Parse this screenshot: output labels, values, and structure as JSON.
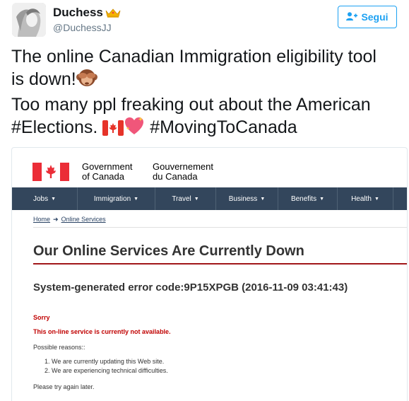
{
  "tweet": {
    "user": {
      "name": "Duchess",
      "handle": "@DuchessJJ",
      "badge_icon": "crown-icon"
    },
    "follow_button": {
      "label": "Segui",
      "icon": "add-user-icon",
      "color": "#1da1f2"
    },
    "text_lines": [
      "The online Canadian Immigration eligibility tool",
      "is down!",
      "Too many ppl freaking out about the American",
      "#Elections.",
      "#MovingToCanada"
    ],
    "emojis": [
      "see-no-evil-monkey-icon",
      "canada-flag-icon",
      "sparkling-heart-icon"
    ]
  },
  "embedded_page": {
    "header": {
      "gov_en_line1": "Government",
      "gov_en_line2": "of Canada",
      "gov_fr_line1": "Gouvernement",
      "gov_fr_line2": "du Canada",
      "flag_color": "#eb2d37"
    },
    "nav": {
      "background": "#33465c",
      "items": [
        "Jobs",
        "Immigration",
        "Travel",
        "Business",
        "Benefits",
        "Health"
      ]
    },
    "breadcrumb": {
      "home": "Home",
      "current": "Online Services"
    },
    "title": "Our Online Services Are Currently Down",
    "error_code": "System-generated error code:9P15XPGB (2016-11-09 03:41:43)",
    "sorry": "Sorry",
    "not_available": "This on-line service is currently not available.",
    "reasons_heading": "Possible reasons::",
    "reasons": [
      "We are currently updating this Web site.",
      "We are experiencing technical difficulties."
    ],
    "try_later": "Please try again later."
  }
}
